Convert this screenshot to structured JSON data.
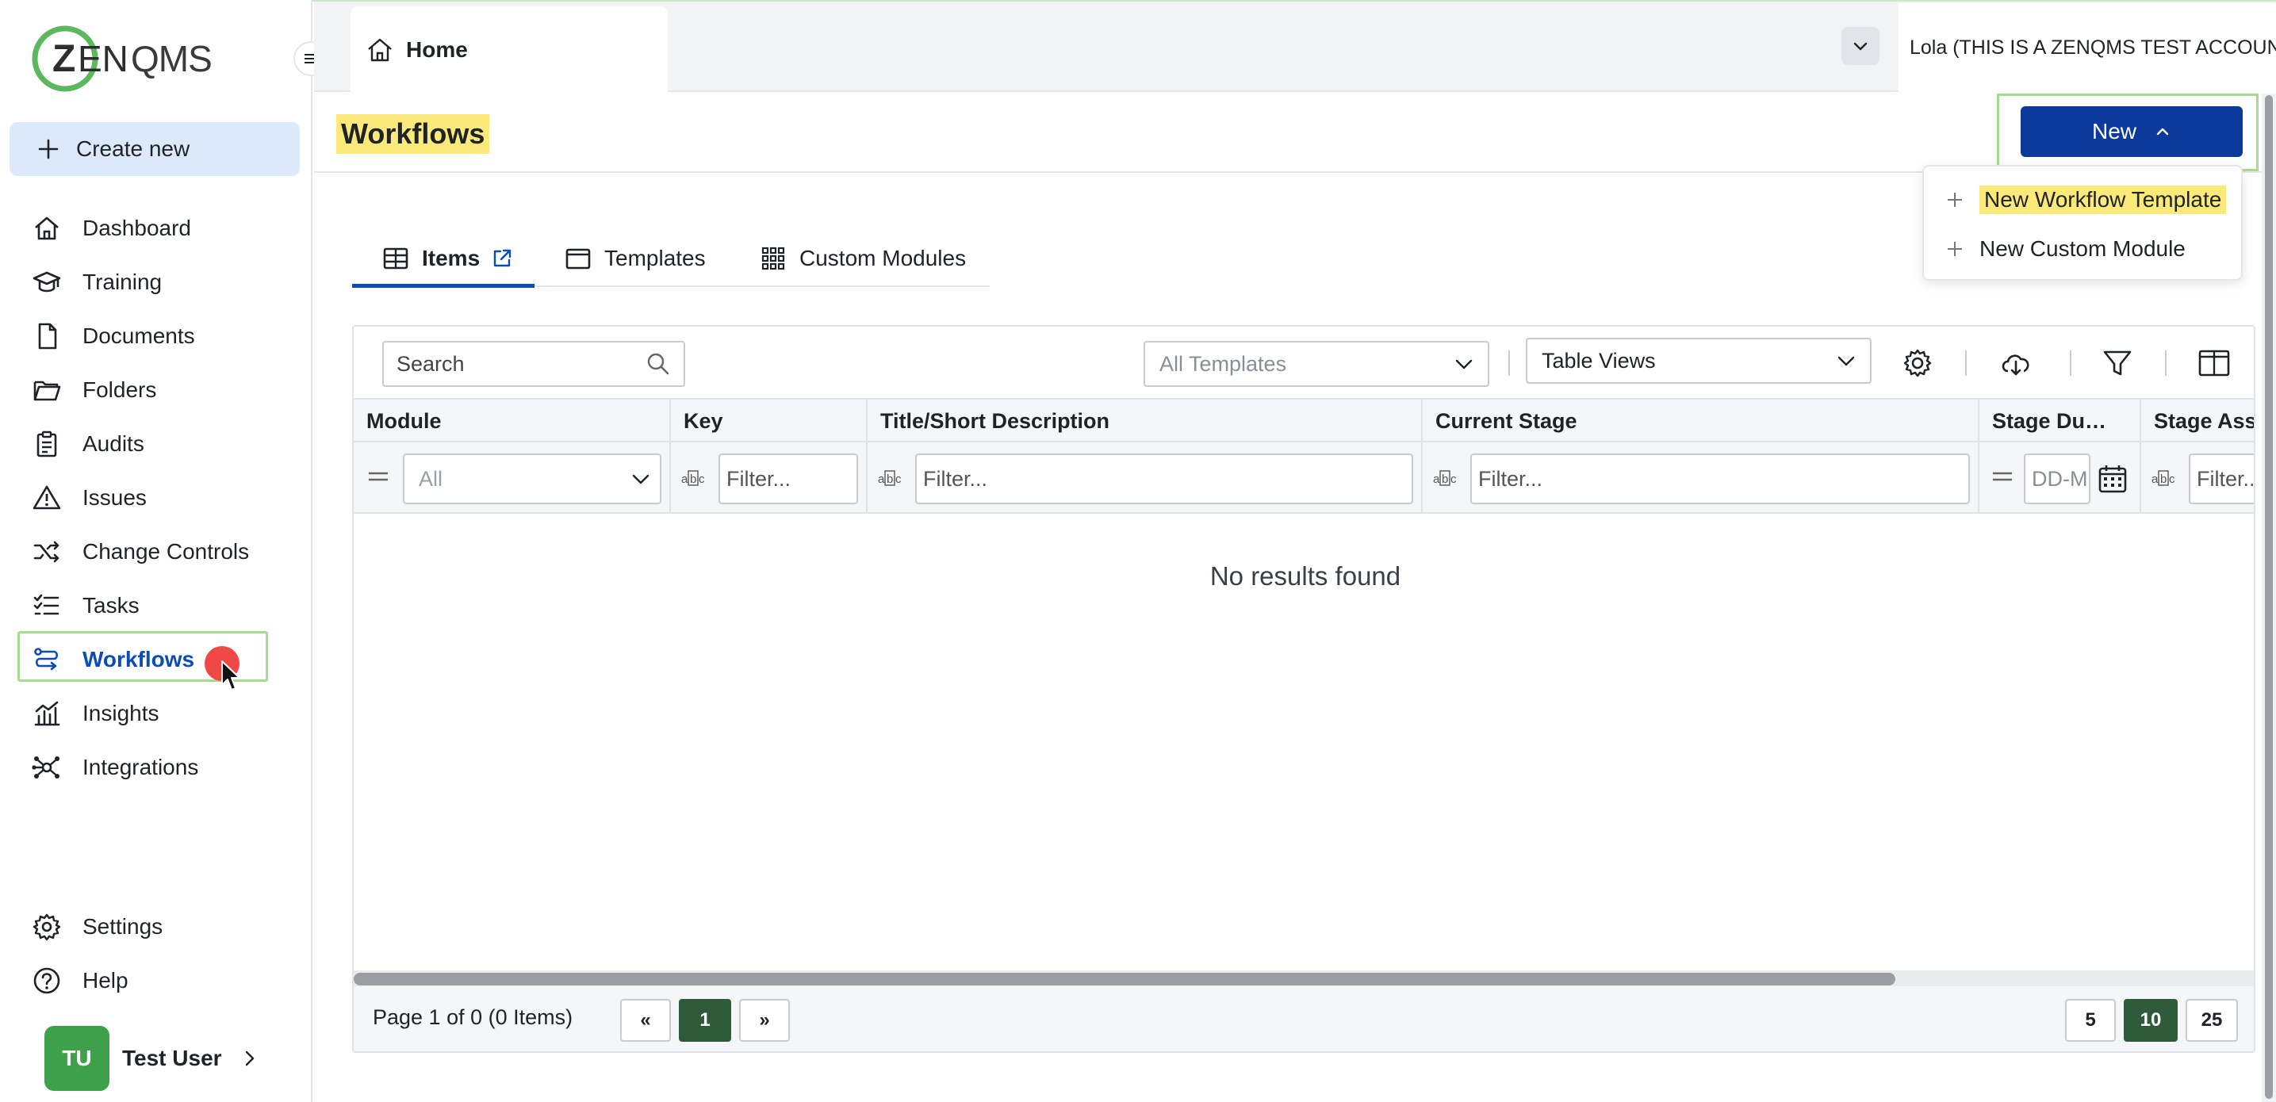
{
  "app": {
    "brand": "ZENQMS"
  },
  "colors": {
    "primary": "#0b3a9c",
    "active_nav": "#0b4cb5",
    "highlight": "#fbe97a",
    "focus_outline": "#a7dc8e",
    "pager_current": "#2f5a3a",
    "avatar": "#3ea04a"
  },
  "sidebar": {
    "create_new": "Create new",
    "items": [
      {
        "label": "Dashboard",
        "icon": "home-icon"
      },
      {
        "label": "Training",
        "icon": "graduation-cap-icon"
      },
      {
        "label": "Documents",
        "icon": "document-icon"
      },
      {
        "label": "Folders",
        "icon": "folder-icon"
      },
      {
        "label": "Audits",
        "icon": "clipboard-icon"
      },
      {
        "label": "Issues",
        "icon": "warning-icon"
      },
      {
        "label": "Change Controls",
        "icon": "shuffle-icon"
      },
      {
        "label": "Tasks",
        "icon": "task-list-icon"
      },
      {
        "label": "Workflows",
        "icon": "workflow-icon",
        "active": true
      },
      {
        "label": "Insights",
        "icon": "chart-icon"
      },
      {
        "label": "Integrations",
        "icon": "network-icon"
      }
    ],
    "bottom": [
      {
        "label": "Settings",
        "icon": "gear-icon"
      },
      {
        "label": "Help",
        "icon": "help-icon"
      }
    ],
    "user": {
      "initials": "TU",
      "name": "Test User"
    }
  },
  "topbar": {
    "tab_home": "Home",
    "account": "Lola (THIS IS A ZENQMS TEST ACCOUNT)"
  },
  "header": {
    "title": "Workflows",
    "new_button": "New",
    "menu": [
      "New Workflow Template",
      "New Custom Module"
    ]
  },
  "tabs": [
    {
      "label": "Items",
      "active": true
    },
    {
      "label": "Templates"
    },
    {
      "label": "Custom Modules"
    }
  ],
  "grid": {
    "search_placeholder": "Search",
    "template_select": "All Templates",
    "view_select": "Table Views",
    "columns": [
      "Module",
      "Key",
      "Title/Short Description",
      "Current Stage",
      "Stage Du…",
      "Stage Assi"
    ],
    "filters": {
      "module": "All",
      "key": "Filter...",
      "title": "Filter...",
      "stage": "Filter...",
      "date": "DD-M",
      "assignee": "Filter..."
    },
    "empty_message": "No results found",
    "pager": {
      "summary": "Page 1 of 0 (0 Items)",
      "prev": "«",
      "current": "1",
      "next": "»",
      "sizes": [
        "5",
        "10",
        "25"
      ],
      "selected_size": "10"
    }
  }
}
